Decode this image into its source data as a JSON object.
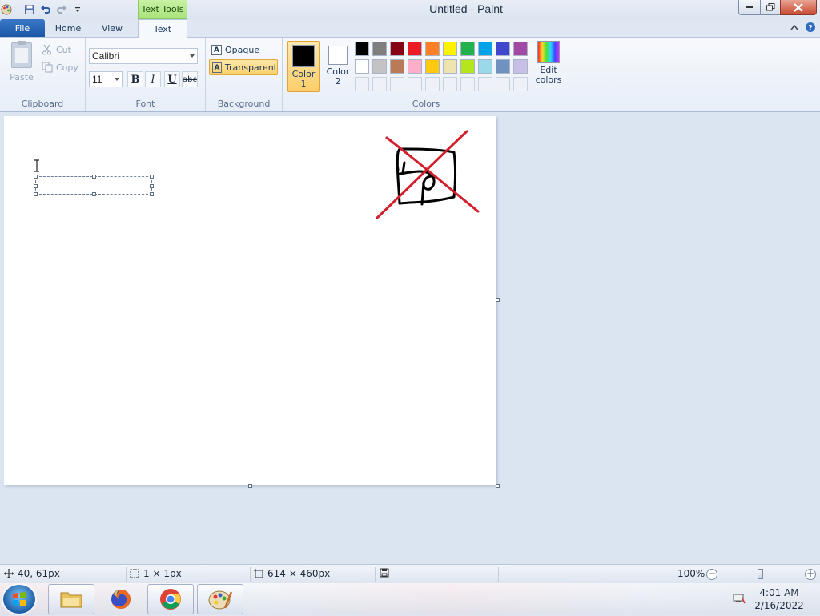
{
  "window": {
    "title": "Untitled - Paint",
    "contextual_tab_group": "Text Tools"
  },
  "tabs": {
    "file": "File",
    "home": "Home",
    "view": "View",
    "text": "Text"
  },
  "ribbon": {
    "clipboard": {
      "label": "Clipboard",
      "paste": "Paste",
      "cut": "Cut",
      "copy": "Copy"
    },
    "font": {
      "label": "Font",
      "family": "Calibri",
      "size": "11",
      "bold": "B",
      "italic": "I",
      "underline": "U",
      "strikethrough": "abc"
    },
    "background": {
      "label": "Background",
      "opaque": "Opaque",
      "transparent": "Transparent",
      "selected": "Transparent"
    },
    "colors": {
      "label": "Colors",
      "color1": {
        "label_line1": "Color",
        "label_line2": "1",
        "value": "#000000"
      },
      "color2": {
        "label_line1": "Color",
        "label_line2": "2",
        "value": "#ffffff"
      },
      "edit_line1": "Edit",
      "edit_line2": "colors",
      "palette": [
        "#000000",
        "#7f7f7f",
        "#880015",
        "#ed1c24",
        "#ff7f27",
        "#fff200",
        "#22b14c",
        "#00a2e8",
        "#3f48cc",
        "#a349a4",
        "#ffffff",
        "#c3c3c3",
        "#b97a57",
        "#ffaec9",
        "#ffc90e",
        "#efe4b0",
        "#b5e61d",
        "#99d9ea",
        "#7092be",
        "#c8bfe7",
        "",
        "",
        "",
        "",
        "",
        "",
        "",
        "",
        "",
        ""
      ]
    }
  },
  "status": {
    "cursor_position": "40, 61px",
    "selection_size": "1 × 1px",
    "image_size": "614 × 460px",
    "zoom": "100%"
  },
  "taskbar": {
    "apps": [
      "file-explorer",
      "firefox",
      "chrome",
      "paint"
    ],
    "time": "4:01 AM",
    "date": "2/16/2022"
  }
}
